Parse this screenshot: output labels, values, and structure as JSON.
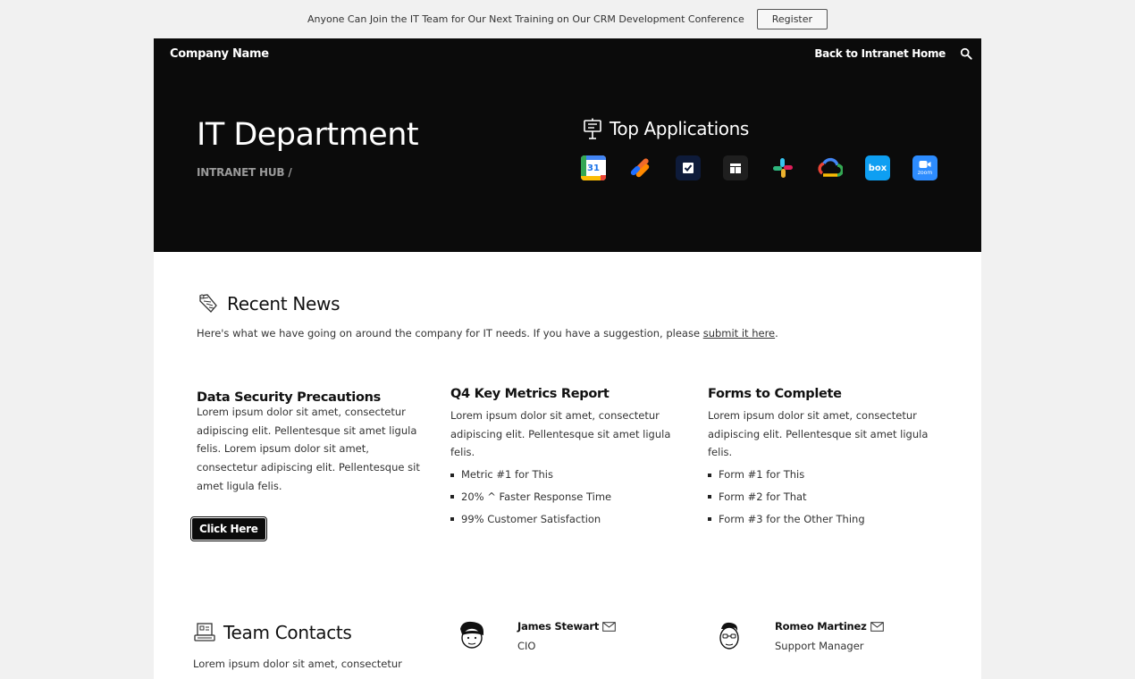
{
  "banner": {
    "text": "Anyone Can Join the IT Team for Our Next Training on Our CRM Development Conference",
    "button_label": "Register"
  },
  "header": {
    "company": "Company Name",
    "back_link": "Back to Intranet Home",
    "title": "IT Department",
    "breadcrumb": "INTRANET HUB /"
  },
  "top_apps": {
    "title": "Top Applications",
    "apps": [
      {
        "name": "google-calendar",
        "label": "31"
      },
      {
        "name": "asana-like",
        "label": ""
      },
      {
        "name": "todoist-like",
        "label": ""
      },
      {
        "name": "notion-like",
        "label": ""
      },
      {
        "name": "slack",
        "label": ""
      },
      {
        "name": "google-cloud",
        "label": ""
      },
      {
        "name": "box",
        "label": "box"
      },
      {
        "name": "zoom",
        "label": "zoom"
      }
    ]
  },
  "news": {
    "title": "Recent News",
    "intro_text": "Here's what we have going on around the company for IT needs. If you have a suggestion, please ",
    "intro_link": "submit it here",
    "intro_end": ".",
    "columns": [
      {
        "title": "Data Security Precautions",
        "body": "Lorem ipsum dolor sit amet, consectetur adipiscing elit. Pellentesque sit amet ligula felis. Lorem ipsum dolor sit amet, consectetur adipiscing elit. Pellentesque sit amet ligula felis.",
        "button": "Click Here"
      },
      {
        "title": "Q4 Key Metrics Report",
        "body": "Lorem ipsum dolor sit amet, consectetur adipiscing elit. Pellentesque sit amet ligula felis.",
        "items": [
          "Metric #1 for This",
          "20% ^  Faster Response Time",
          "99% Customer Satisfaction"
        ]
      },
      {
        "title": "Forms to Complete",
        "body": "Lorem ipsum dolor sit amet, consectetur adipiscing elit. Pellentesque sit amet ligula felis.",
        "items": [
          "Form #1 for This",
          "Form #2 for That",
          "Form #3 for the Other Thing"
        ]
      }
    ]
  },
  "team": {
    "title": "Team Contacts",
    "description": "Lorem ipsum dolor sit amet, consectetur",
    "contacts": [
      {
        "name": "James Stewart",
        "role": "CIO"
      },
      {
        "name": "Romeo Martinez",
        "role": "Support Manager"
      }
    ]
  },
  "colors": {
    "hero_bg": "#0b0b0b",
    "page_bg": "#f1f1f1",
    "content_bg": "#ffffff",
    "muted_text": "#9a9a9a"
  }
}
